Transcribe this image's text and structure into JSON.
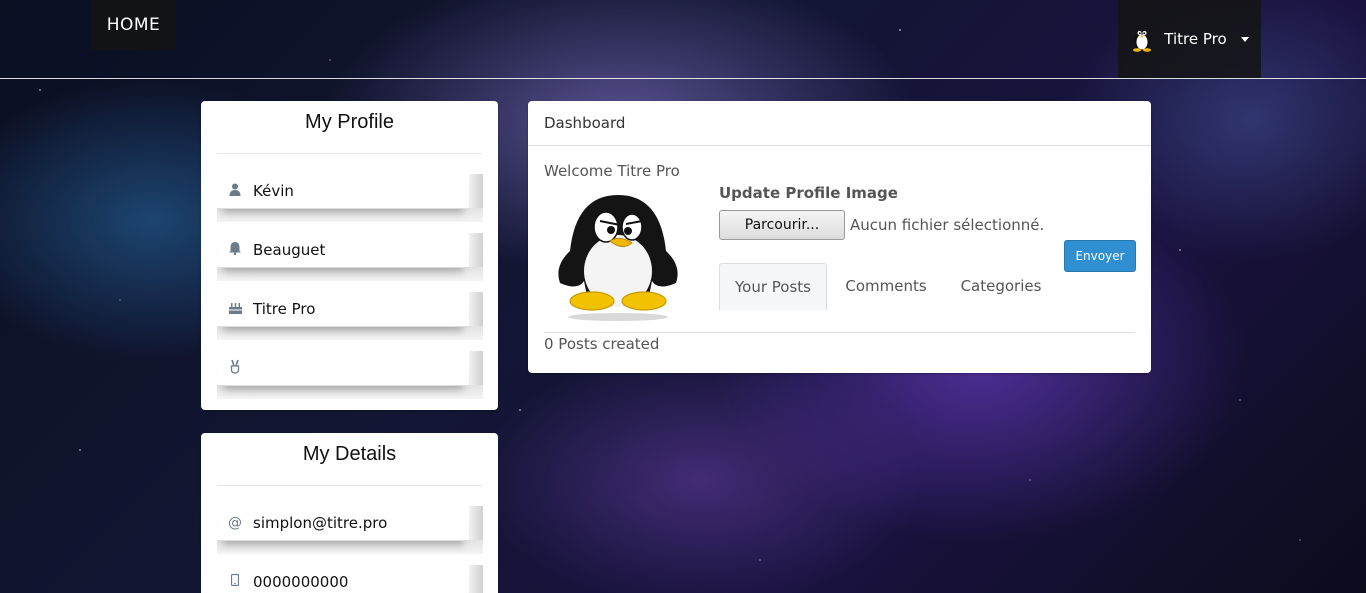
{
  "navbar": {
    "home_label": "HOME",
    "user_name": "Titre Pro",
    "user_avatar_icon": "tux-penguin-icon",
    "dropdown_icon": "caret-down-icon"
  },
  "profile": {
    "title": "My Profile",
    "items": [
      {
        "icon": "user-icon",
        "value": "Kévin"
      },
      {
        "icon": "bell-icon",
        "value": "Beauguet"
      },
      {
        "icon": "birthday-cake-icon",
        "value": "Titre Pro"
      },
      {
        "icon": "victory-hand-icon",
        "value": ""
      }
    ]
  },
  "details": {
    "title": "My Details",
    "items": [
      {
        "icon": "at-icon",
        "value": "simplon@titre.pro"
      },
      {
        "icon": "mobile-icon",
        "value": "0000000000"
      }
    ]
  },
  "dashboard": {
    "title": "Dashboard",
    "welcome": "Welcome Titre Pro",
    "update_image_label": "Update Profile Image",
    "browse_label": "Parcourir...",
    "no_file_text": "Aucun fichier sélectionné.",
    "submit_label": "Envoyer",
    "tabs": [
      "Your Posts",
      "Comments",
      "Categories"
    ],
    "active_tab": "Your Posts",
    "posts_count": "0 Posts created"
  },
  "colors": {
    "primary_button": "#2f8fd0",
    "panel_bg": "#ffffff",
    "nav_bg": "#141414"
  }
}
